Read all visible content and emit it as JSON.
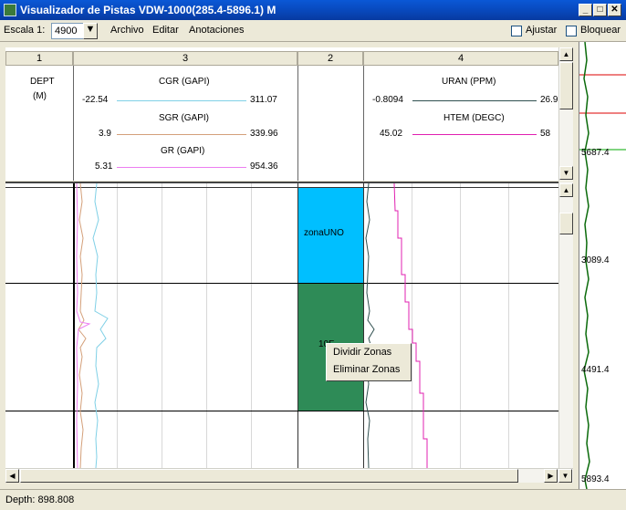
{
  "window": {
    "title": "Visualizador de Pistas VDW-1000(285.4-5896.1) M",
    "buttons": [
      "_",
      "□",
      "✕"
    ]
  },
  "toolbar": {
    "scale_label": "Escala 1:",
    "scale_value": "4900",
    "menu": [
      "Archivo",
      "Editar",
      "Anotaciones"
    ],
    "ajustar_label": "Ajustar",
    "bloquear_label": "Bloquear"
  },
  "tracks": {
    "headers": [
      "1",
      "3",
      "2",
      "4"
    ],
    "track1": {
      "label": "DEPT",
      "unit": "(M)"
    },
    "track3": [
      {
        "name": "CGR  (GAPI)",
        "min": "-22.54",
        "max": "311.07",
        "color": "#7fd0e6"
      },
      {
        "name": "SGR  (GAPI)",
        "min": "3.9",
        "max": "339.96",
        "color": "#d4a07a"
      },
      {
        "name": "GR   (GAPI)",
        "min": "5.31",
        "max": "954.36",
        "color": "#ec7ef0"
      }
    ],
    "track4": [
      {
        "name": "URAN (PPM)",
        "min": "-0.8094",
        "max": "26.9",
        "color": "#2f4f4f"
      },
      {
        "name": "HTEM (DEGC)",
        "min": "45.02",
        "max": "58",
        "color": "#e020b0"
      }
    ]
  },
  "zones": [
    {
      "label": "zonaUNO",
      "color": "#00bfff"
    },
    {
      "label": "10F",
      "color": "#2e8b57"
    }
  ],
  "context_menu": {
    "items": [
      "Dividir Zonas",
      "Eliminar Zonas"
    ]
  },
  "depth_bar": {
    "labels": [
      "5687.4",
      "3089.4",
      "4491.4",
      "5893.4"
    ]
  },
  "status": {
    "text": "Depth: 898.808"
  }
}
